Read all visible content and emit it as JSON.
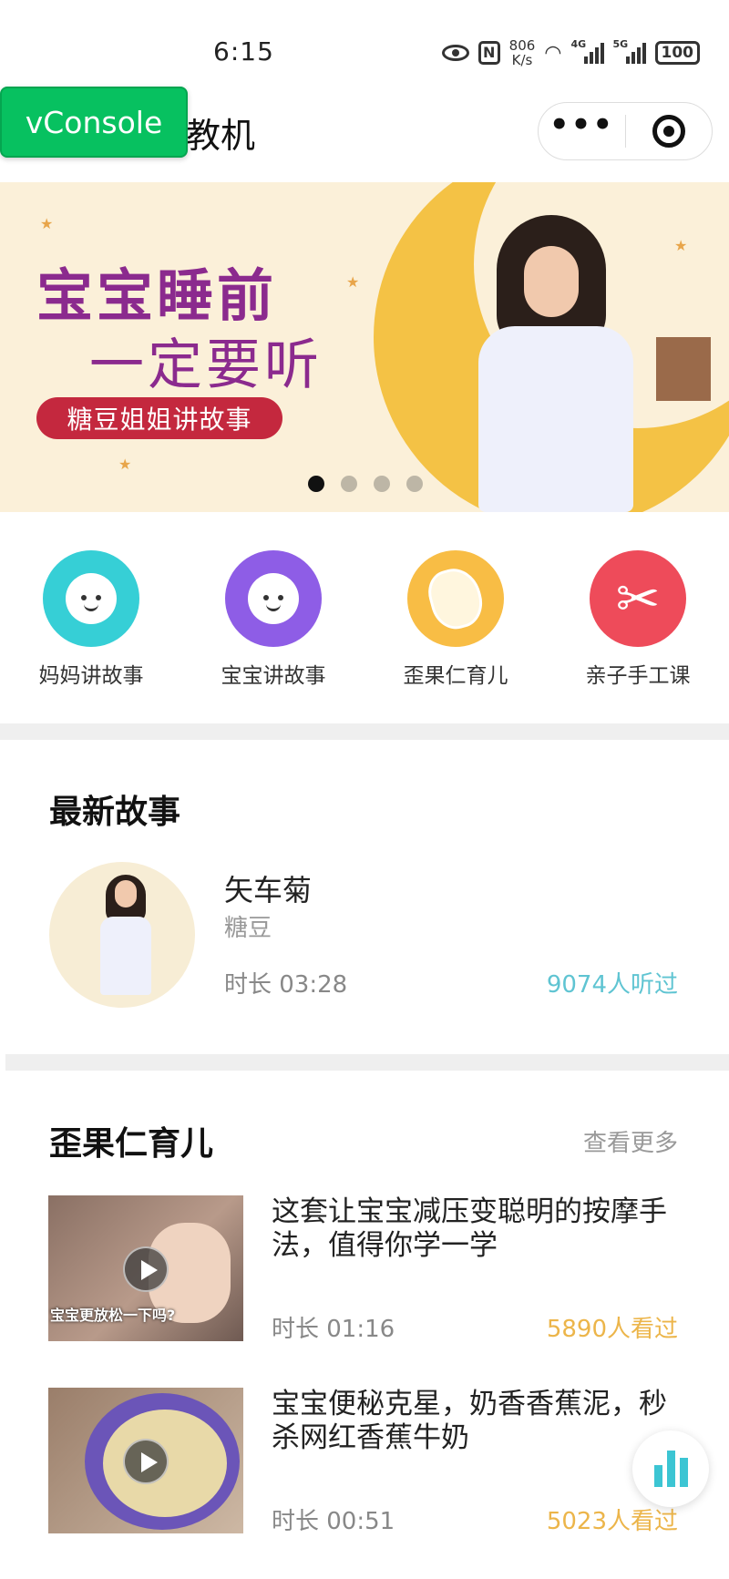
{
  "status_bar": {
    "time": "6:15",
    "net_speed_value": "806",
    "net_speed_unit": "K/s",
    "sig1_label": "4G",
    "sig2_label": "5G",
    "battery": "100"
  },
  "title_bar": {
    "title_partial": "教机",
    "vconsole_label": "vConsole",
    "more_label": "•••"
  },
  "banner": {
    "headline_1": "宝宝睡前",
    "headline_2": "一定要听",
    "tag": "糖豆姐姐讲故事",
    "slide_count": 4,
    "active_slide": 1
  },
  "categories": [
    {
      "label": "妈妈讲故事",
      "color": "#36cfd6",
      "icon": "mom-face-icon"
    },
    {
      "label": "宝宝讲故事",
      "color": "#8e5de6",
      "icon": "baby-face-icon"
    },
    {
      "label": "歪果仁育儿",
      "color": "#f8bd45",
      "icon": "bean-icon"
    },
    {
      "label": "亲子手工课",
      "color": "#ee4b5a",
      "icon": "scissors-icon"
    }
  ],
  "latest": {
    "section_title": "最新故事",
    "story": {
      "name": "矢车菊",
      "author": "糖豆",
      "duration": "时长 03:28",
      "listens": "9074人听过"
    }
  },
  "parenting": {
    "section_title": "歪果仁育儿",
    "more_label": "查看更多",
    "videos": [
      {
        "title": "这套让宝宝减压变聪明的按摩手法，值得你学一学",
        "caption": "宝宝更放松一下吗?",
        "duration": "时长 01:16",
        "views": "5890人看过"
      },
      {
        "title": "宝宝便秘克星，奶香香蕉泥，秒杀网红香蕉牛奶",
        "caption": "",
        "duration": "时长 00:51",
        "views": "5023人看过"
      }
    ]
  },
  "colors": {
    "accent_teal": "#5fc4d2",
    "accent_orange": "#ecb54a",
    "vconsole_green": "#07c160",
    "banner_purple": "#8b2a8e",
    "banner_red": "#c4283e"
  }
}
